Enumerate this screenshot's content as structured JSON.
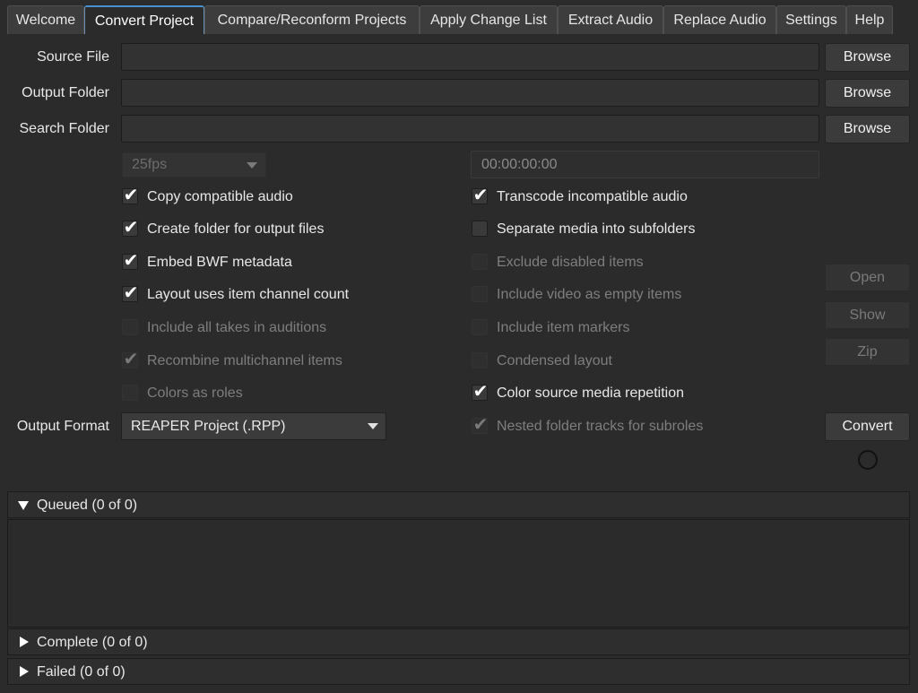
{
  "tabs": [
    {
      "label": "Welcome",
      "active": false
    },
    {
      "label": "Convert Project",
      "active": true
    },
    {
      "label": "Compare/Reconform Projects",
      "active": false
    },
    {
      "label": "Apply Change List",
      "active": false
    },
    {
      "label": "Extract Audio",
      "active": false
    },
    {
      "label": "Replace Audio",
      "active": false
    },
    {
      "label": "Settings",
      "active": false
    },
    {
      "label": "Help",
      "active": false
    }
  ],
  "form": {
    "source_file": {
      "label": "Source File",
      "value": "",
      "browse": "Browse"
    },
    "output_folder": {
      "label": "Output Folder",
      "value": "",
      "browse": "Browse"
    },
    "search_folder": {
      "label": "Search Folder",
      "value": "",
      "browse": "Browse"
    },
    "frame_rate": {
      "value": "25fps",
      "enabled": false
    },
    "start_timecode": {
      "value": "00:00:00:00",
      "enabled": false
    }
  },
  "options_left": [
    {
      "label": "Copy compatible audio",
      "checked": true,
      "enabled": true
    },
    {
      "label": "Create folder for output files",
      "checked": true,
      "enabled": true
    },
    {
      "label": "Embed BWF metadata",
      "checked": true,
      "enabled": true
    },
    {
      "label": "Layout uses item channel count",
      "checked": true,
      "enabled": true
    },
    {
      "label": "Include all takes in auditions",
      "checked": false,
      "enabled": false
    },
    {
      "label": "Recombine multichannel items",
      "checked": true,
      "enabled": false
    },
    {
      "label": "Colors as roles",
      "checked": false,
      "enabled": false
    }
  ],
  "options_right": [
    {
      "label": "Transcode incompatible audio",
      "checked": true,
      "enabled": true
    },
    {
      "label": "Separate media into subfolders",
      "checked": false,
      "enabled": true
    },
    {
      "label": "Exclude disabled items",
      "checked": false,
      "enabled": false
    },
    {
      "label": "Include video as empty items",
      "checked": false,
      "enabled": false
    },
    {
      "label": "Include item markers",
      "checked": false,
      "enabled": false
    },
    {
      "label": "Condensed layout",
      "checked": false,
      "enabled": false
    },
    {
      "label": "Color source media repetition",
      "checked": true,
      "enabled": true
    },
    {
      "label": "Nested folder tracks for subroles",
      "checked": true,
      "enabled": false
    }
  ],
  "side_buttons": {
    "open": "Open",
    "show": "Show",
    "zip": "Zip",
    "convert": "Convert"
  },
  "output_format": {
    "label": "Output Format",
    "value": "REAPER Project (.RPP)"
  },
  "sections": {
    "queued": "Queued (0 of 0)",
    "complete": "Complete (0 of 0)",
    "failed": "Failed (0 of 0)"
  },
  "check_glyph": "✔"
}
